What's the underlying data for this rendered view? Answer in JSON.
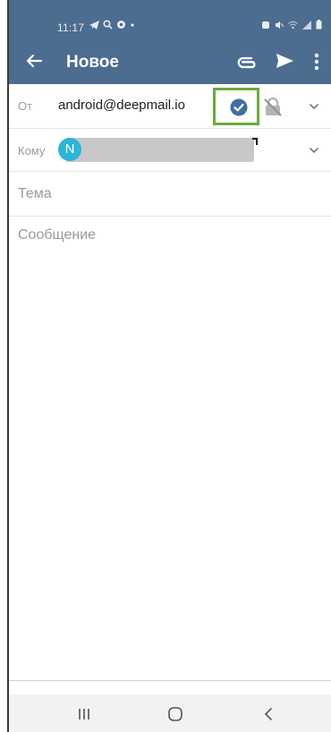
{
  "status_bar": {
    "time": "11:17",
    "left_icons": [
      "telegram-icon",
      "search-icon",
      "settings-badge-icon",
      "dot-icon"
    ],
    "right_icons": [
      "alarm-icon",
      "mute-icon",
      "wifi-icon",
      "signal-icon",
      "battery-icon"
    ]
  },
  "toolbar": {
    "title": "Новое",
    "icons": [
      "back-arrow-icon",
      "attach-icon",
      "send-icon",
      "more-vert-icon"
    ],
    "background_color": "#4c6c90"
  },
  "compose": {
    "from_label": "От",
    "from_address": "android@deepmail.io",
    "to_label": "Кому",
    "to_avatar_letter": "N",
    "to_avatar_color": "#2bb5d6",
    "subject_placeholder": "Тема",
    "message_placeholder": "Сообщение",
    "verified_color": "#3f6ea3",
    "highlight_color": "#6aab3e"
  },
  "nav_bar": {
    "icons": [
      "recents-icon",
      "home-icon",
      "back-icon"
    ]
  }
}
